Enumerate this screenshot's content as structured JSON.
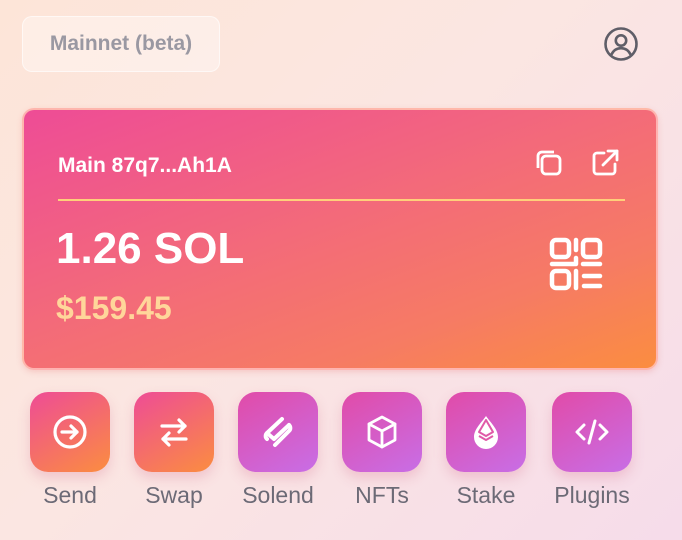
{
  "header": {
    "network_label": "Mainnet (beta)",
    "account_icon": "user-circle-icon"
  },
  "wallet": {
    "name": "Main 87q7...Ah1A",
    "balance_sol": "1.26 SOL",
    "balance_usd": "$159.45",
    "icons": [
      "copy-icon",
      "external-link-icon",
      "qr-code-icon"
    ],
    "divider_color": "#ffcf7a"
  },
  "actions": [
    {
      "label": "Send",
      "icon": "arrow-circle-right-icon"
    },
    {
      "label": "Swap",
      "icon": "swap-arrows-icon"
    },
    {
      "label": "Solend",
      "icon": "solend-logo-icon"
    },
    {
      "label": "NFTs",
      "icon": "cube-icon"
    },
    {
      "label": "Stake",
      "icon": "water-drop-icon"
    },
    {
      "label": "Plugins",
      "icon": "code-icon"
    }
  ],
  "colors": {
    "card_gradient_start": "#ee4c96",
    "card_gradient_end": "#fb8d40",
    "usd_text": "#ffd69a",
    "label_text": "#6c6a76",
    "network_text": "#9a98a2"
  }
}
